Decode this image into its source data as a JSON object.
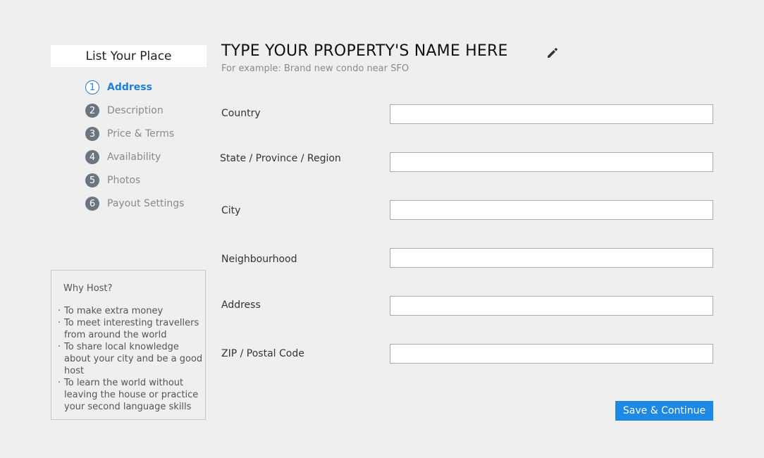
{
  "sidebar": {
    "title": "List Your Place",
    "steps": [
      {
        "number": "1",
        "label": "Address",
        "active": true
      },
      {
        "number": "2",
        "label": "Description",
        "active": false
      },
      {
        "number": "3",
        "label": "Price & Terms",
        "active": false
      },
      {
        "number": "4",
        "label": "Availability",
        "active": false
      },
      {
        "number": "5",
        "label": "Photos",
        "active": false
      },
      {
        "number": "6",
        "label": "Payout Settings",
        "active": false
      }
    ],
    "why_host": {
      "title": "Why Host?",
      "items": [
        "To make extra money",
        "To meet interesting travellers from around the world",
        "To share local knowledge about your city and be a good host",
        "To learn the world without leaving the house or practice your second language skills"
      ]
    }
  },
  "header": {
    "property_name": "TYPE YOUR PROPERTY'S NAME HERE",
    "example": "For example: Brand new condo near SFO",
    "edit_icon": "pencil-icon"
  },
  "form": {
    "country": {
      "label": "Country",
      "value": ""
    },
    "state": {
      "label": "State / Province / Region",
      "value": ""
    },
    "city": {
      "label": "City",
      "value": ""
    },
    "neighbourhood": {
      "label": "Neighbourhood",
      "value": ""
    },
    "address": {
      "label": "Address",
      "value": ""
    },
    "zip": {
      "label": "ZIP / Postal Code",
      "value": ""
    }
  },
  "actions": {
    "save_label": "Save & Continue"
  },
  "colors": {
    "accent": "#1e88e5",
    "active_step": "#1e7fd6",
    "step_badge": "#6b7580",
    "background": "#efefef"
  }
}
